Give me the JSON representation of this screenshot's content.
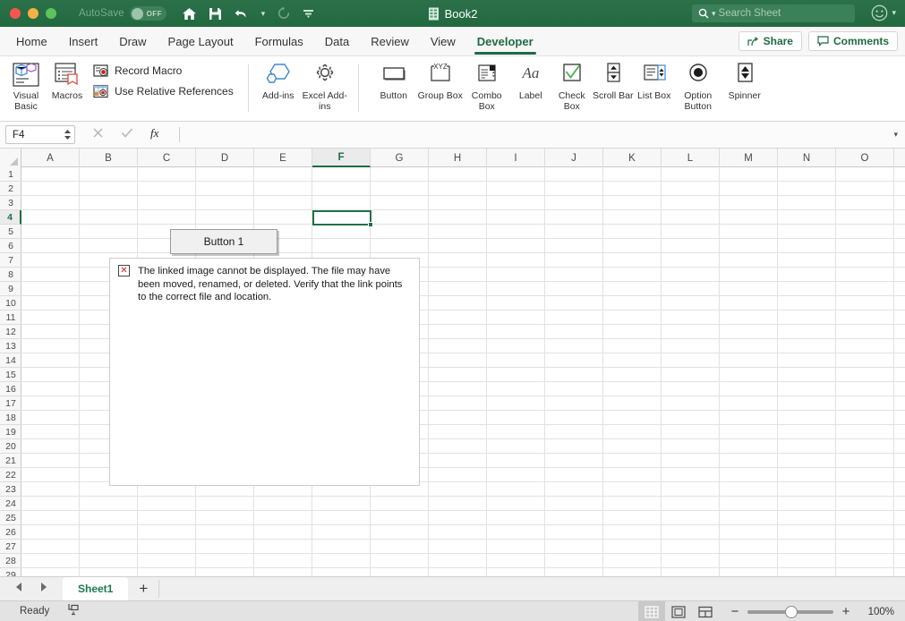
{
  "titlebar": {
    "autosave_label": "AutoSave",
    "autosave_state": "OFF",
    "document_name": "Book2",
    "search_placeholder": "Search Sheet",
    "icons": [
      "home-icon",
      "save-icon",
      "undo-icon",
      "redo-icon",
      "customize-toolbar-icon"
    ],
    "accent_green": "#226940"
  },
  "tabs": [
    {
      "label": "Home",
      "active": false
    },
    {
      "label": "Insert",
      "active": false
    },
    {
      "label": "Draw",
      "active": false
    },
    {
      "label": "Page Layout",
      "active": false
    },
    {
      "label": "Formulas",
      "active": false
    },
    {
      "label": "Data",
      "active": false
    },
    {
      "label": "Review",
      "active": false
    },
    {
      "label": "View",
      "active": false
    },
    {
      "label": "Developer",
      "active": true
    }
  ],
  "tabbar_right": {
    "share_label": "Share",
    "comments_label": "Comments"
  },
  "ribbon": {
    "code_group": {
      "visual_basic": "Visual Basic",
      "macros": "Macros",
      "record_macro": "Record Macro",
      "use_relative_references": "Use Relative References"
    },
    "addins_group": {
      "addins": "Add-ins",
      "excel_addins": "Excel Add-ins"
    },
    "controls_group": [
      {
        "label": "Button",
        "icon": "button-control-icon"
      },
      {
        "label": "Group Box",
        "icon": "group-box-icon"
      },
      {
        "label": "Combo Box",
        "icon": "combo-box-icon"
      },
      {
        "label": "Label",
        "icon": "label-control-icon"
      },
      {
        "label": "Check Box",
        "icon": "check-box-icon"
      },
      {
        "label": "Scroll Bar",
        "icon": "scroll-bar-icon"
      },
      {
        "label": "List Box",
        "icon": "list-box-icon"
      },
      {
        "label": "Option Button",
        "icon": "option-button-icon"
      },
      {
        "label": "Spinner",
        "icon": "spinner-icon"
      }
    ]
  },
  "formulabar": {
    "name_box_value": "F4",
    "formula_value": "",
    "cancel_icon": "cancel-x-icon",
    "enter_icon": "enter-check-icon",
    "function_icon": "fx-icon",
    "expand_icon": "chevron-down-icon"
  },
  "grid": {
    "columns": [
      "A",
      "B",
      "C",
      "D",
      "E",
      "F",
      "G",
      "H",
      "I",
      "J",
      "K",
      "L",
      "M",
      "N",
      "O"
    ],
    "selected_column": "F",
    "rows": [
      1,
      2,
      3,
      4,
      5,
      6,
      7,
      8,
      9,
      10,
      11,
      12,
      13,
      14,
      15,
      16,
      17,
      18,
      19,
      20,
      21,
      22,
      23,
      24,
      25,
      26,
      27,
      28,
      29
    ],
    "selected_row": 4,
    "selected_cell": "F4",
    "form_button": {
      "label": "Button 1"
    },
    "broken_image": {
      "message": "The linked image cannot be displayed.  The file may have been moved, renamed, or deleted. Verify that the link points to the correct file and location.",
      "icon": "broken-image-x-icon"
    }
  },
  "sheetbar": {
    "prev_icon": "prev-sheet-icon",
    "next_icon": "next-sheet-icon",
    "sheets": [
      {
        "name": "Sheet1",
        "active": true
      }
    ],
    "add_sheet_label": "+"
  },
  "statusbar": {
    "status_text": "Ready",
    "accessibility_icon": "accessibility-check-icon",
    "views": [
      {
        "name": "normal-view",
        "active": true
      },
      {
        "name": "page-layout-view",
        "active": false
      },
      {
        "name": "page-break-view",
        "active": false
      }
    ],
    "zoom_minus": "−",
    "zoom_plus": "+",
    "zoom_level": "100%"
  }
}
